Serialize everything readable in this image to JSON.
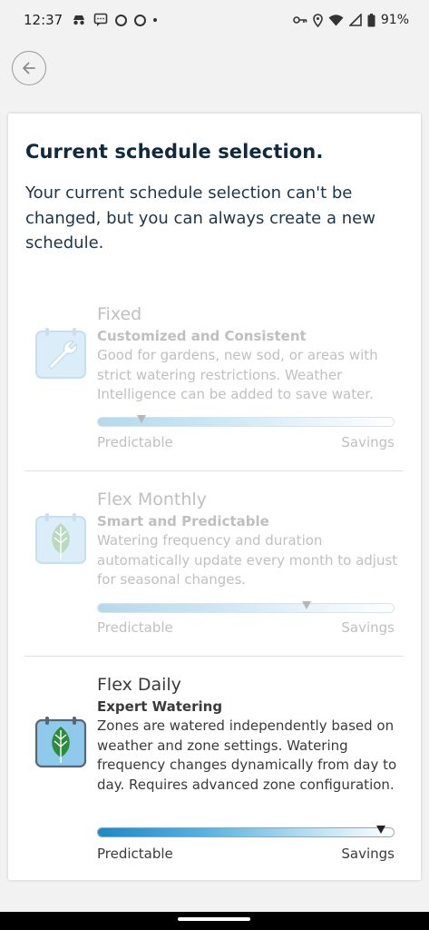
{
  "status_bar": {
    "time": "12:37",
    "battery": "91%",
    "icons": [
      "incognito-icon",
      "chat-icon",
      "circle-icon",
      "circle-icon",
      "dot-icon",
      "key-icon",
      "location-icon",
      "wifi-icon",
      "signal-icon",
      "battery-icon"
    ]
  },
  "header": {
    "back_icon": "back-arrow-icon"
  },
  "card": {
    "title": "Current schedule selection.",
    "subtitle": "Your current schedule selection can't be changed, but you can always create a new schedule."
  },
  "options": [
    {
      "title": "Fixed",
      "subtitle": "Customized and Consistent",
      "description": "Good for gardens, new sod, or areas with strict watering restrictions. Weather Intelligence can be added to save water.",
      "icon": "wrench-calendar-icon",
      "slider_position": 0.15,
      "left_label": "Predictable",
      "right_label": "Savings",
      "selected": false
    },
    {
      "title": "Flex Monthly",
      "subtitle": "Smart and Predictable",
      "description": "Watering frequency and duration automatically update every month to adjust for seasonal changes.",
      "icon": "leaf-calendar-icon",
      "slider_position": 0.7,
      "left_label": "Predictable",
      "right_label": "Savings",
      "selected": false
    },
    {
      "title": "Flex Daily",
      "subtitle": "Expert Watering",
      "description": "Zones are watered independently based on weather and zone settings. Watering frequency changes dynamically from day to day. Requires advanced zone configuration.",
      "icon": "leaf-calendar-icon",
      "slider_position": 0.95,
      "left_label": "Predictable",
      "right_label": "Savings",
      "selected": true
    }
  ],
  "colors": {
    "title": "#0f2a3c",
    "slider_start": "#1e88c6",
    "icon_blue": "#8fc9ec",
    "leaf_green": "#2e8b3a"
  }
}
